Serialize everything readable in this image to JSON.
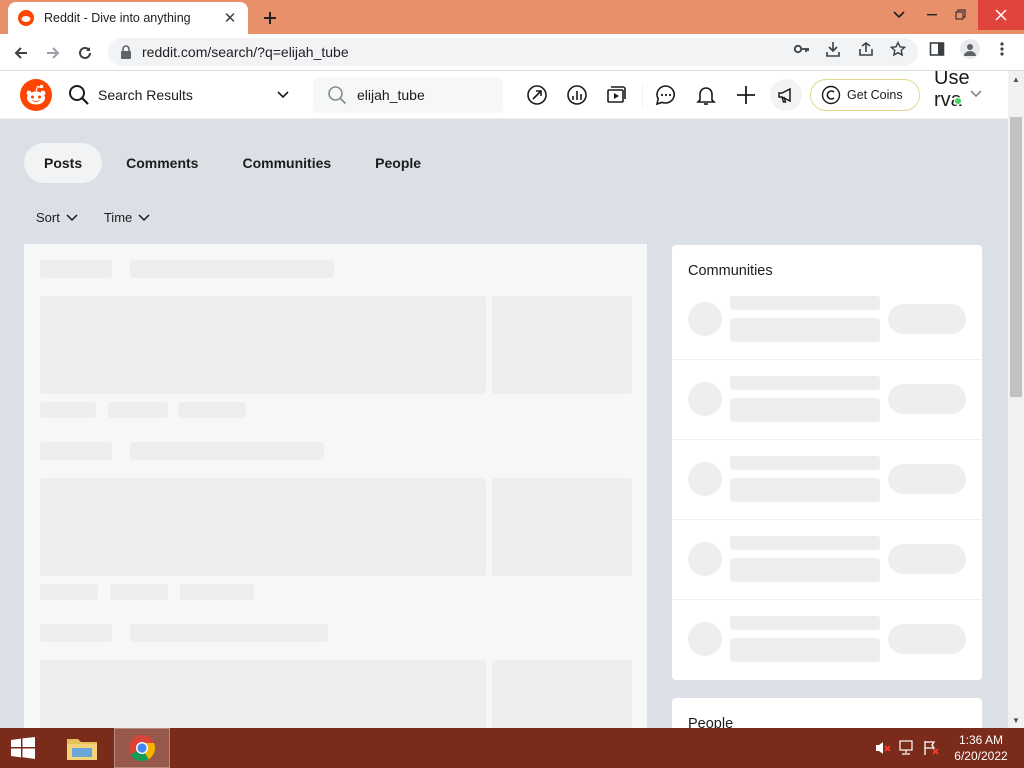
{
  "browser": {
    "tab_title": "Reddit - Dive into anything",
    "url": "reddit.com/search/?q=elijah_tube",
    "tab_close": "✕",
    "newtab_icon": "plus-icon"
  },
  "header": {
    "feed_label": "Search Results",
    "search_value": "elijah_tube",
    "coins_label": "Get Coins",
    "user_name": "Use rva"
  },
  "search_tabs": [
    {
      "label": "Posts",
      "active": true
    },
    {
      "label": "Comments",
      "active": false
    },
    {
      "label": "Communities",
      "active": false
    },
    {
      "label": "People",
      "active": false
    }
  ],
  "filters": {
    "sort_label": "Sort",
    "time_label": "Time"
  },
  "sidebar": {
    "communities_title": "Communities",
    "people_title": "People"
  },
  "taskbar": {
    "time": "1:36 AM",
    "date": "6/20/2022"
  },
  "colors": {
    "reddit_orange": "#ff4500",
    "tab_strip": "#e8906a",
    "taskbar": "#7a2b1a",
    "page_bg": "#dae0e6"
  }
}
